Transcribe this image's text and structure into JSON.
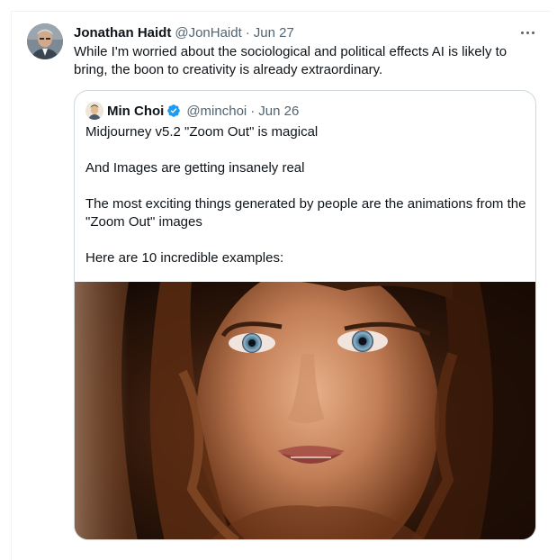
{
  "tweet": {
    "author_name": "Jonathan Haidt",
    "author_handle": "@JonHaidt",
    "separator": "·",
    "date": "Jun 27",
    "text": "While I'm worried about the sociological and political effects AI is likely to bring, the boon to creativity is already extraordinary.",
    "more_icon": "more-horizontal-icon"
  },
  "quote": {
    "author_name": "Min Choi",
    "verified_icon": "verified-badge-icon",
    "author_handle": "@minchoi",
    "separator": "·",
    "date": "Jun 26",
    "paragraphs": [
      "Midjourney v5.2 \"Zoom Out\" is magical",
      "And Images are getting insanely real",
      "The most exciting things generated by people are the animations from the \"Zoom Out\" images",
      "Here are 10 incredible examples:"
    ]
  },
  "colors": {
    "text": "#0f1419",
    "muted": "#536471",
    "border": "#cfd9de",
    "verified": "#1d9bf0"
  }
}
